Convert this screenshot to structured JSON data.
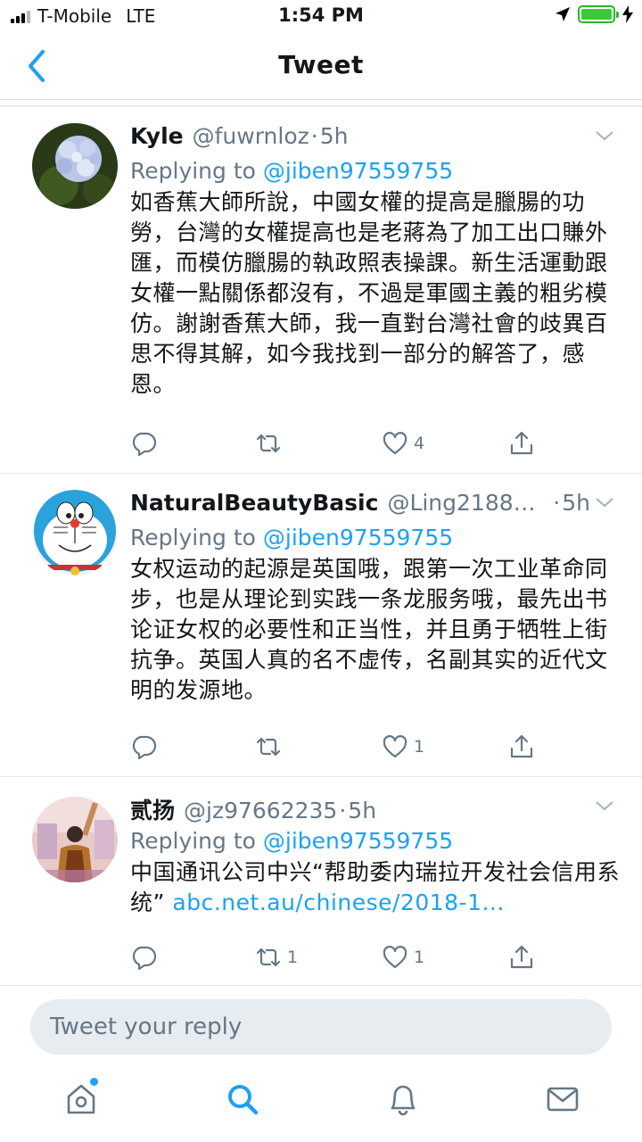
{
  "status_bar": {
    "carrier": "T-Mobile",
    "network": "LTE",
    "time": "1:54 PM",
    "battery_level": 1.0
  },
  "nav": {
    "title": "Tweet",
    "back_icon": "chevron-left-icon"
  },
  "tweets": [
    {
      "name": "Kyle",
      "handle": "@fuwrnloz",
      "time": "5h",
      "replying_label": "Replying to",
      "replying_to": "@jiben97559755",
      "text": "如香蕉大師所說，中國女權的提高是臘腸的功勞，台灣的女權提高也是老蔣為了加工出口賺外匯，而模仿臘腸的執政照表操課。新生活運動跟女權一點關係都沒有，不過是軍國主義的粗劣模仿。謝謝香蕉大師，我一直對台灣社會的歧異百思不得其解，如今我找到一部分的解答了，感恩。",
      "retweets": "",
      "likes": "4"
    },
    {
      "name": "NaturalBeautyBasic",
      "handle": "@Ling21880...",
      "time": "5h",
      "replying_label": "Replying to",
      "replying_to": "@jiben97559755",
      "text": "女权运动的起源是英国哦，跟第一次工业革命同步，也是从理论到实践一条龙服务哦，最先出书论证女权的必要性和正当性，并且勇于牺牲上街抗争。英国人真的名不虚传，名副其实的近代文明的发源地。",
      "retweets": "",
      "likes": "1"
    },
    {
      "name": "贰扬",
      "handle": "@jz97662235",
      "time": "5h",
      "replying_label": "Replying to",
      "replying_to": "@jiben97559755",
      "text": "中国通讯公司中兴“帮助委内瑞拉开发社会信用系统”",
      "link": "abc.net.au/chinese/2018-1...",
      "retweets": "1",
      "likes": "1"
    }
  ],
  "reply_box": {
    "placeholder": "Tweet your reply"
  },
  "tab_bar": {
    "items": [
      "home-icon",
      "search-icon",
      "notifications-icon",
      "messages-icon"
    ],
    "active": "search-icon"
  },
  "colors": {
    "accent": "#1da1f2",
    "text": "#14171a",
    "secondary": "#657786",
    "battery": "#3cc83c"
  }
}
